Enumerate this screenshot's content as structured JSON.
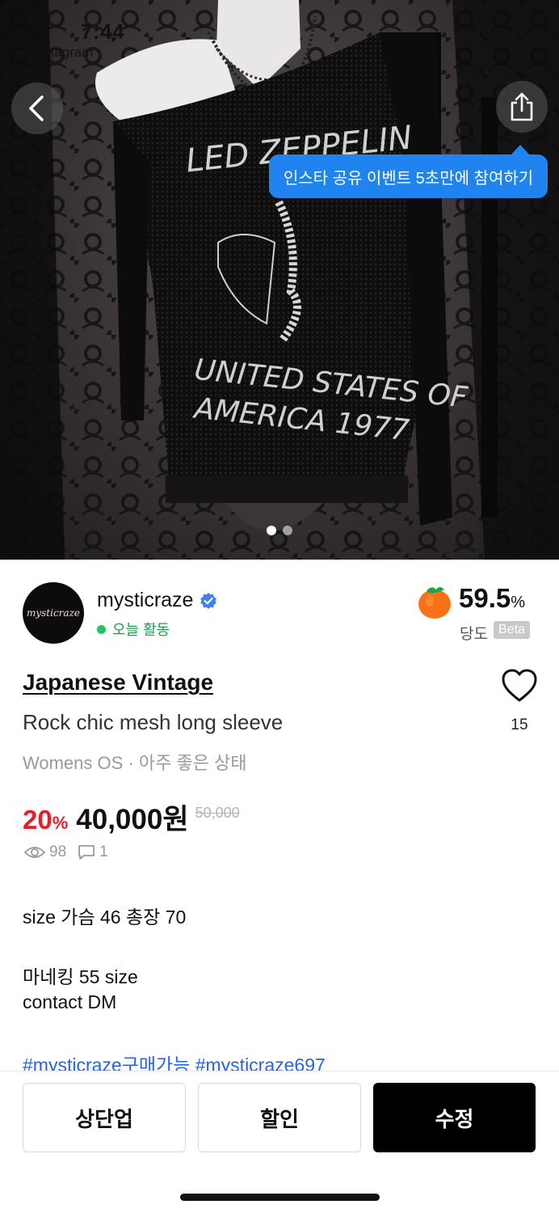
{
  "status_bar": {
    "time": "7:44",
    "back_app": "◀ Instagram"
  },
  "share_tooltip": "인스타 공유 이벤트 5초만에 참여하기",
  "image_pager": {
    "count": 2,
    "active": 0
  },
  "seller": {
    "name": "mysticraze",
    "verified": true,
    "activity": "오늘 활동",
    "avatar_text": "mysticraze"
  },
  "sweetness": {
    "value": "59.5",
    "unit": "%",
    "label": "당도",
    "badge": "Beta"
  },
  "product": {
    "brand": "Japanese Vintage",
    "title": "Rock chic mesh long sleeve",
    "meta": "Womens OS · 아주 좋은 상태",
    "discount": "20",
    "discount_unit": "%",
    "price": "40,000원",
    "original_price": "50,000",
    "likes": "15",
    "views": "98",
    "comments": "1"
  },
  "description": {
    "line1": "size 가슴 46 총장 70",
    "line2": "마네킹 55 size",
    "line3": "contact DM",
    "hashtags": "#mysticraze구매가능 #mysticraze697"
  },
  "actions": {
    "bump": "상단업",
    "discount": "할인",
    "edit": "수정"
  },
  "colors": {
    "accent_blue": "#1f83f0",
    "discount_red": "#e41e2b",
    "active_green": "#22c55e",
    "link_blue": "#2563eb"
  }
}
